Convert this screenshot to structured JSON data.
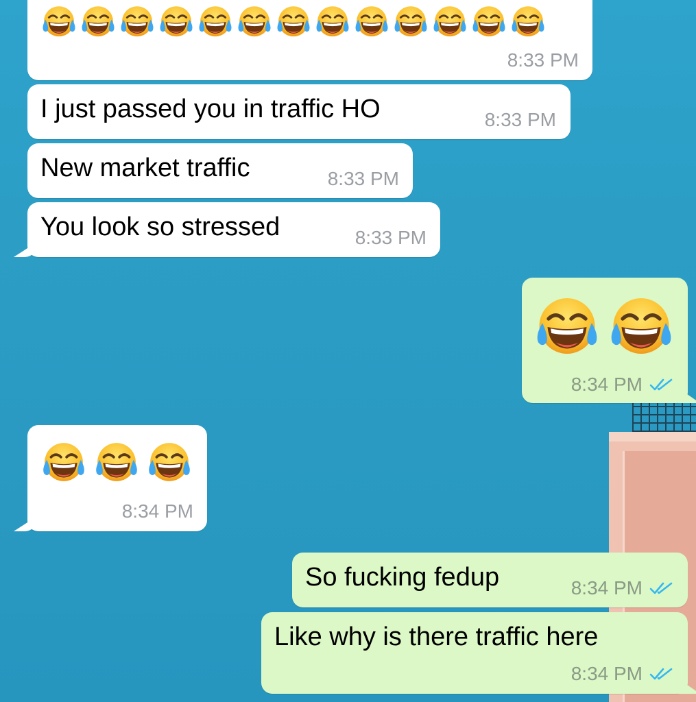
{
  "colors": {
    "wallpaper": "#2a9ec5",
    "incoming_bubble": "#ffffff",
    "outgoing_bubble": "#dcf8c6",
    "timestamp": "#9a9ea3",
    "read_ticks": "#34b7f1"
  },
  "icons": {
    "emoji": "face-with-tears-of-joy",
    "read_receipt": "double-check-icon"
  },
  "messages": [
    {
      "direction": "incoming",
      "text": "",
      "emoji_count": 13,
      "time": "8:33 PM"
    },
    {
      "direction": "incoming",
      "text": "I just passed you in traffic HO",
      "time": "8:33 PM"
    },
    {
      "direction": "incoming",
      "text": "New market traffic",
      "time": "8:33 PM"
    },
    {
      "direction": "incoming",
      "text": "You look so stressed",
      "time": "8:33 PM"
    },
    {
      "direction": "outgoing",
      "text": "",
      "emoji_count": 2,
      "time": "8:34 PM",
      "read": true
    },
    {
      "direction": "incoming",
      "text": "",
      "emoji_count": 3,
      "time": "8:34 PM"
    },
    {
      "direction": "outgoing",
      "text": "So fucking fedup",
      "time": "8:34 PM",
      "read": true
    },
    {
      "direction": "outgoing",
      "text": "Like why is there traffic here",
      "time": "8:34 PM",
      "read": true
    }
  ]
}
